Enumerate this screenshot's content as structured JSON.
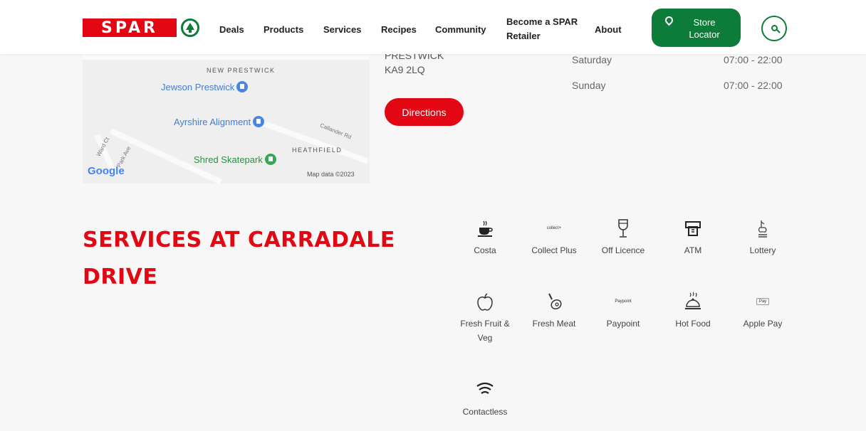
{
  "brand": {
    "logo_text": "SPAR",
    "accent": "#e30613",
    "green": "#0d7c3a"
  },
  "nav": {
    "deals": "Deals",
    "products": "Products",
    "services": "Services",
    "recipes": "Recipes",
    "community": "Community",
    "become_line1": "Become a SPAR",
    "become_line2": "Retailer",
    "about": "About",
    "store_line1": "Store",
    "store_line2": "Locator"
  },
  "map": {
    "area_new_prestwick": "NEW PRESTWICK",
    "area_heathfield": "HEATHFIELD",
    "place1": "Jewson Prestwick",
    "place2": "Ayrshire Alignment",
    "place3": "Shred Skatepark",
    "street1": "Callander Rd",
    "street2": "Ward Ct",
    "street3": "Park Ave",
    "google": "Google",
    "map_data": "Map data ©2023"
  },
  "address": {
    "town": "PRESTWICK",
    "postcode": "KA9 2LQ",
    "directions": "Directions"
  },
  "hours": [
    {
      "day": "Saturday",
      "time": "07:00 - 22:00"
    },
    {
      "day": "Sunday",
      "time": "07:00 - 22:00"
    }
  ],
  "services_title": "SERVICES AT CARRADALE DRIVE",
  "services": [
    {
      "label": "Costa",
      "icon": "coffee-cup-icon"
    },
    {
      "label": "Collect Plus",
      "icon": "collect-plus-icon",
      "icon_text": "collect+"
    },
    {
      "label": "Off Licence",
      "icon": "wine-glass-icon"
    },
    {
      "label": "ATM",
      "icon": "atm-icon"
    },
    {
      "label": "Lottery",
      "icon": "lottery-icon"
    },
    {
      "label": "Fresh Fruit & Veg",
      "icon": "apple-icon"
    },
    {
      "label": "Fresh Meat",
      "icon": "meat-icon"
    },
    {
      "label": "Paypoint",
      "icon": "paypoint-icon",
      "icon_text": "Paypoint"
    },
    {
      "label": "Hot Food",
      "icon": "hot-food-icon"
    },
    {
      "label": "Apple Pay",
      "icon": "apple-pay-icon",
      "icon_text": "Pay"
    },
    {
      "label": "Contactless",
      "icon": "contactless-icon"
    }
  ]
}
